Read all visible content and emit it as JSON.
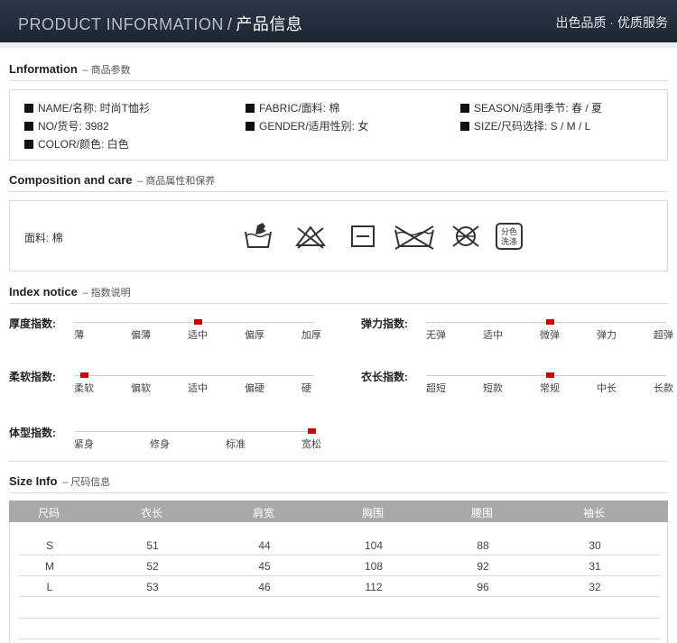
{
  "banner": {
    "en": "PRODUCT INFORMATION",
    "slash": "/",
    "zh": "产品信息",
    "right": "出色品质 · 优质服务"
  },
  "information": {
    "title": "Lnformation",
    "subtitle": "– 商品参数",
    "items": [
      "NAME/名称: 时尚T恤衫",
      "NO/货号: 3982",
      "COLOR/颜色: 白色",
      "FABRIC/面料: 棉",
      "GENDER/适用性别: 女",
      "SEASON/适用季节: 春 / 夏",
      "SIZE/尺码选择: S / M / L"
    ]
  },
  "composition": {
    "title": "Composition and care",
    "subtitle": "– 商品属性和保养",
    "fabric": "面料: 棉",
    "care_icons": [
      "hand-wash-icon",
      "no-bleach-icon",
      "dry-flat-icon",
      "no-tumble-dry-icon",
      "no-dry-clean-icon",
      "wash-separately-icon"
    ],
    "wash_separately_text": [
      "分色",
      "洗涤"
    ]
  },
  "index_notice": {
    "title": "Index notice",
    "subtitle": "– 指数说明",
    "indices": [
      {
        "label": "厚度指数:",
        "options": [
          "薄",
          "偏薄",
          "适中",
          "偏厚",
          "加厚"
        ],
        "selected": 2
      },
      {
        "label": "弹力指数:",
        "options": [
          "无弹",
          "适中",
          "微弹",
          "弹力",
          "超弹"
        ],
        "selected": 2
      },
      {
        "label": "柔软指数:",
        "options": [
          "柔软",
          "偏软",
          "适中",
          "偏硬",
          "硬"
        ],
        "selected": 0
      },
      {
        "label": "衣长指数:",
        "options": [
          "超短",
          "短款",
          "常规",
          "中长",
          "长款"
        ],
        "selected": 2
      },
      {
        "label": "体型指数:",
        "options": [
          "紧身",
          "修身",
          "标准",
          "宽松"
        ],
        "selected": 3
      }
    ]
  },
  "size_info": {
    "title": "Size Info",
    "subtitle": "– 尺码信息",
    "headers": [
      "尺码",
      "衣长",
      "肩宽",
      "胸围",
      "腰围",
      "袖长"
    ],
    "rows": [
      [
        "S",
        "51",
        "44",
        "104",
        "88",
        "30"
      ],
      [
        "M",
        "52",
        "45",
        "108",
        "92",
        "31"
      ],
      [
        "L",
        "53",
        "46",
        "112",
        "96",
        "32"
      ]
    ]
  },
  "colors": {
    "banner_bg": "#232c39",
    "marker": "#cc0000",
    "table_header": "#a9a9a9"
  }
}
